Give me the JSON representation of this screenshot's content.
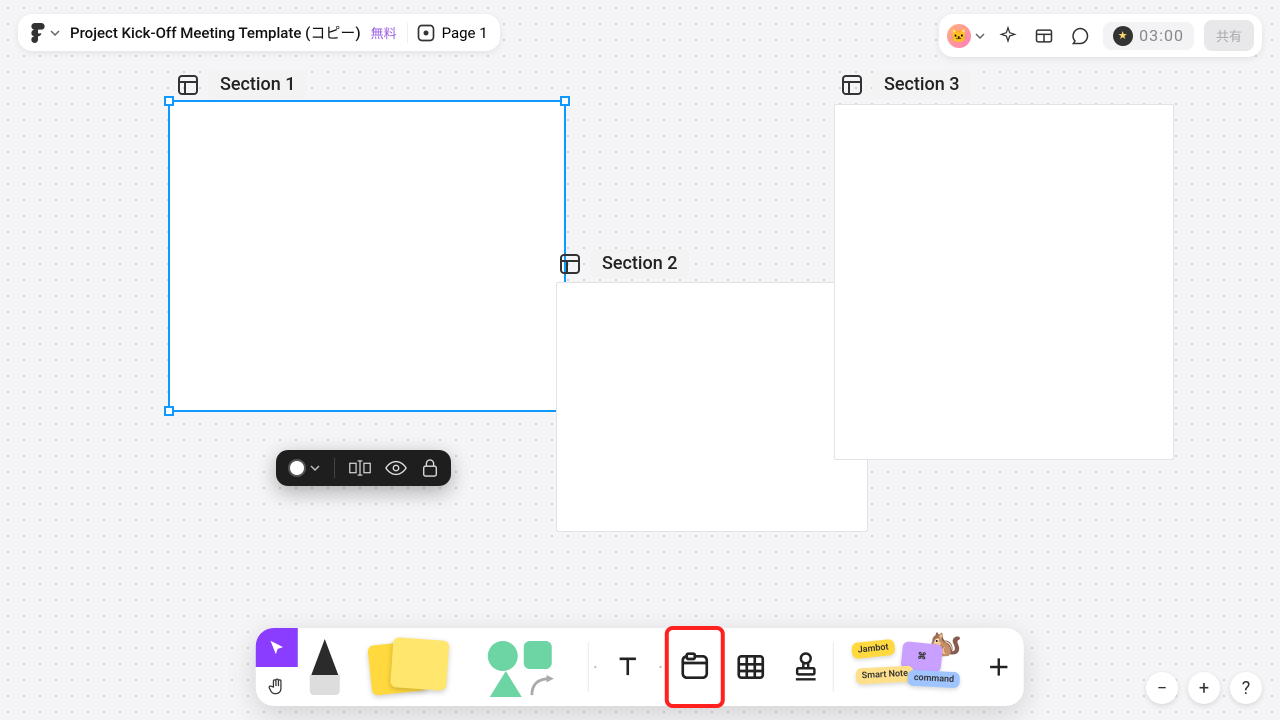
{
  "header": {
    "title": "Project Kick-Off Meeting Template (コピー)",
    "plan_label": "無料",
    "page_label": "Page 1"
  },
  "sections": [
    {
      "label": "Section 1"
    },
    {
      "label": "Section 2"
    },
    {
      "label": "Section 3"
    }
  ],
  "timer": {
    "value": "03:00"
  },
  "share": {
    "label": "共有"
  },
  "widgets": {
    "jambot": "Jambot",
    "smartnote": "Smart Note",
    "command": "command"
  }
}
